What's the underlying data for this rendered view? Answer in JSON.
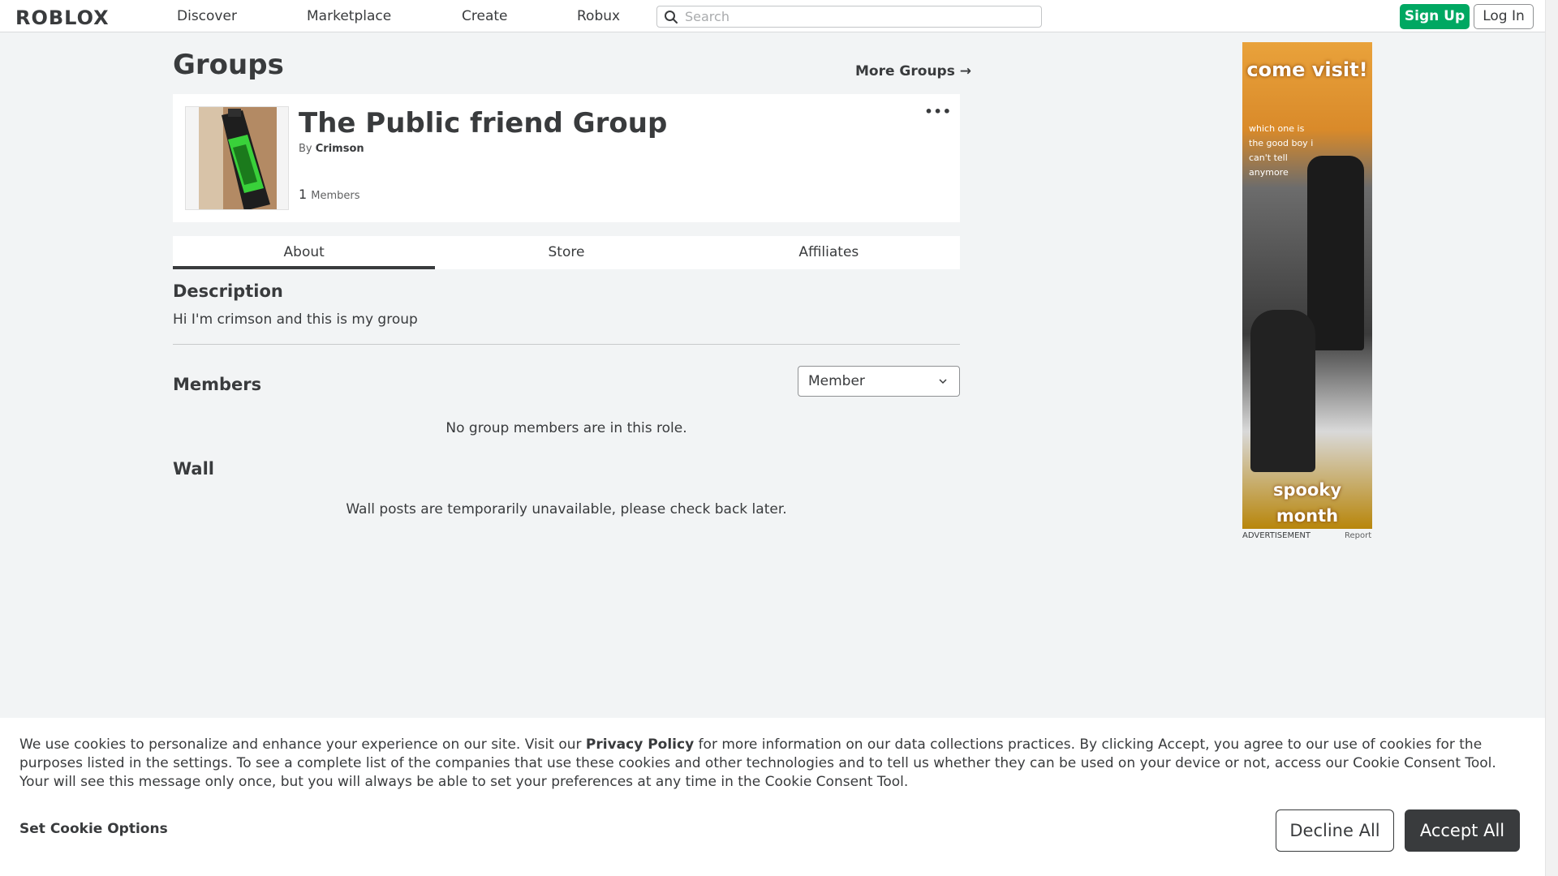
{
  "nav": {
    "logo": "ROBLOX",
    "links": [
      "Discover",
      "Marketplace",
      "Create",
      "Robux"
    ],
    "search_placeholder": "Search",
    "signup_label": "Sign Up",
    "login_label": "Log In"
  },
  "page": {
    "title": "Groups",
    "more_groups_label": "More Groups →"
  },
  "group": {
    "name": "The Public friend Group",
    "by_prefix": "By",
    "owner": "Crimson",
    "member_count": "1",
    "members_label": "Members",
    "more_icon": "•••"
  },
  "tabs": [
    "About",
    "Store",
    "Affiliates"
  ],
  "about": {
    "description_heading": "Description",
    "description_text": "Hi I'm crimson and this is my group",
    "members_heading": "Members",
    "role_selected": "Member",
    "no_members_text": "No group members are in this role.",
    "wall_heading": "Wall",
    "wall_text": "Wall posts are temporarily unavailable, please check back later."
  },
  "ad": {
    "top_text": "come visit!",
    "small_text": "which one is the good boy i can't tell anymore",
    "bottom_text": "spooky month update",
    "label": "ADVERTISEMENT",
    "report": "Report"
  },
  "cookie": {
    "text_before": "We use cookies to personalize and enhance your experience on our site. Visit our ",
    "link": "Privacy Policy",
    "text_after": " for more information on our data collections practices. By clicking Accept, you agree to our use of cookies for the purposes listed in the settings. To see a complete list of the companies that use these cookies and other technologies and to tell us whether they can be used on your device or not, access our Cookie Consent Tool. Your will see this message only once, but you will always be able to set your preferences at any time in the Cookie Consent Tool.",
    "options_label": "Set Cookie Options",
    "decline_label": "Decline All",
    "accept_label": "Accept All"
  }
}
